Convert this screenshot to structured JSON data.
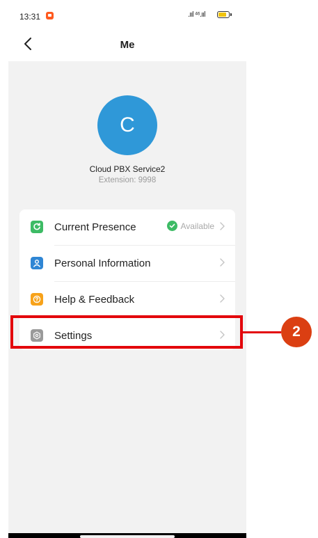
{
  "status_bar": {
    "time": "13:31",
    "signal_text": ".ııl ⁴⁶.ııl",
    "battery_percent": 81
  },
  "navbar": {
    "title": "Me"
  },
  "profile": {
    "avatar_initial": "C",
    "avatar_color": "#2f98d8",
    "name": "Cloud PBX Service2",
    "extension": "Extension: 9998"
  },
  "menu": {
    "items": [
      {
        "label": "Current Presence",
        "icon": "presence-icon",
        "icon_color": "#3dbb65",
        "status": "Available"
      },
      {
        "label": "Personal Information",
        "icon": "person-icon",
        "icon_color": "#2f86d4"
      },
      {
        "label": "Help & Feedback",
        "icon": "help-icon",
        "icon_color": "#f7a21a"
      },
      {
        "label": "Settings",
        "icon": "settings-icon",
        "icon_color": "#9a9a9a"
      }
    ]
  },
  "annotation": {
    "step_number": "2",
    "color": "#e3060b"
  }
}
